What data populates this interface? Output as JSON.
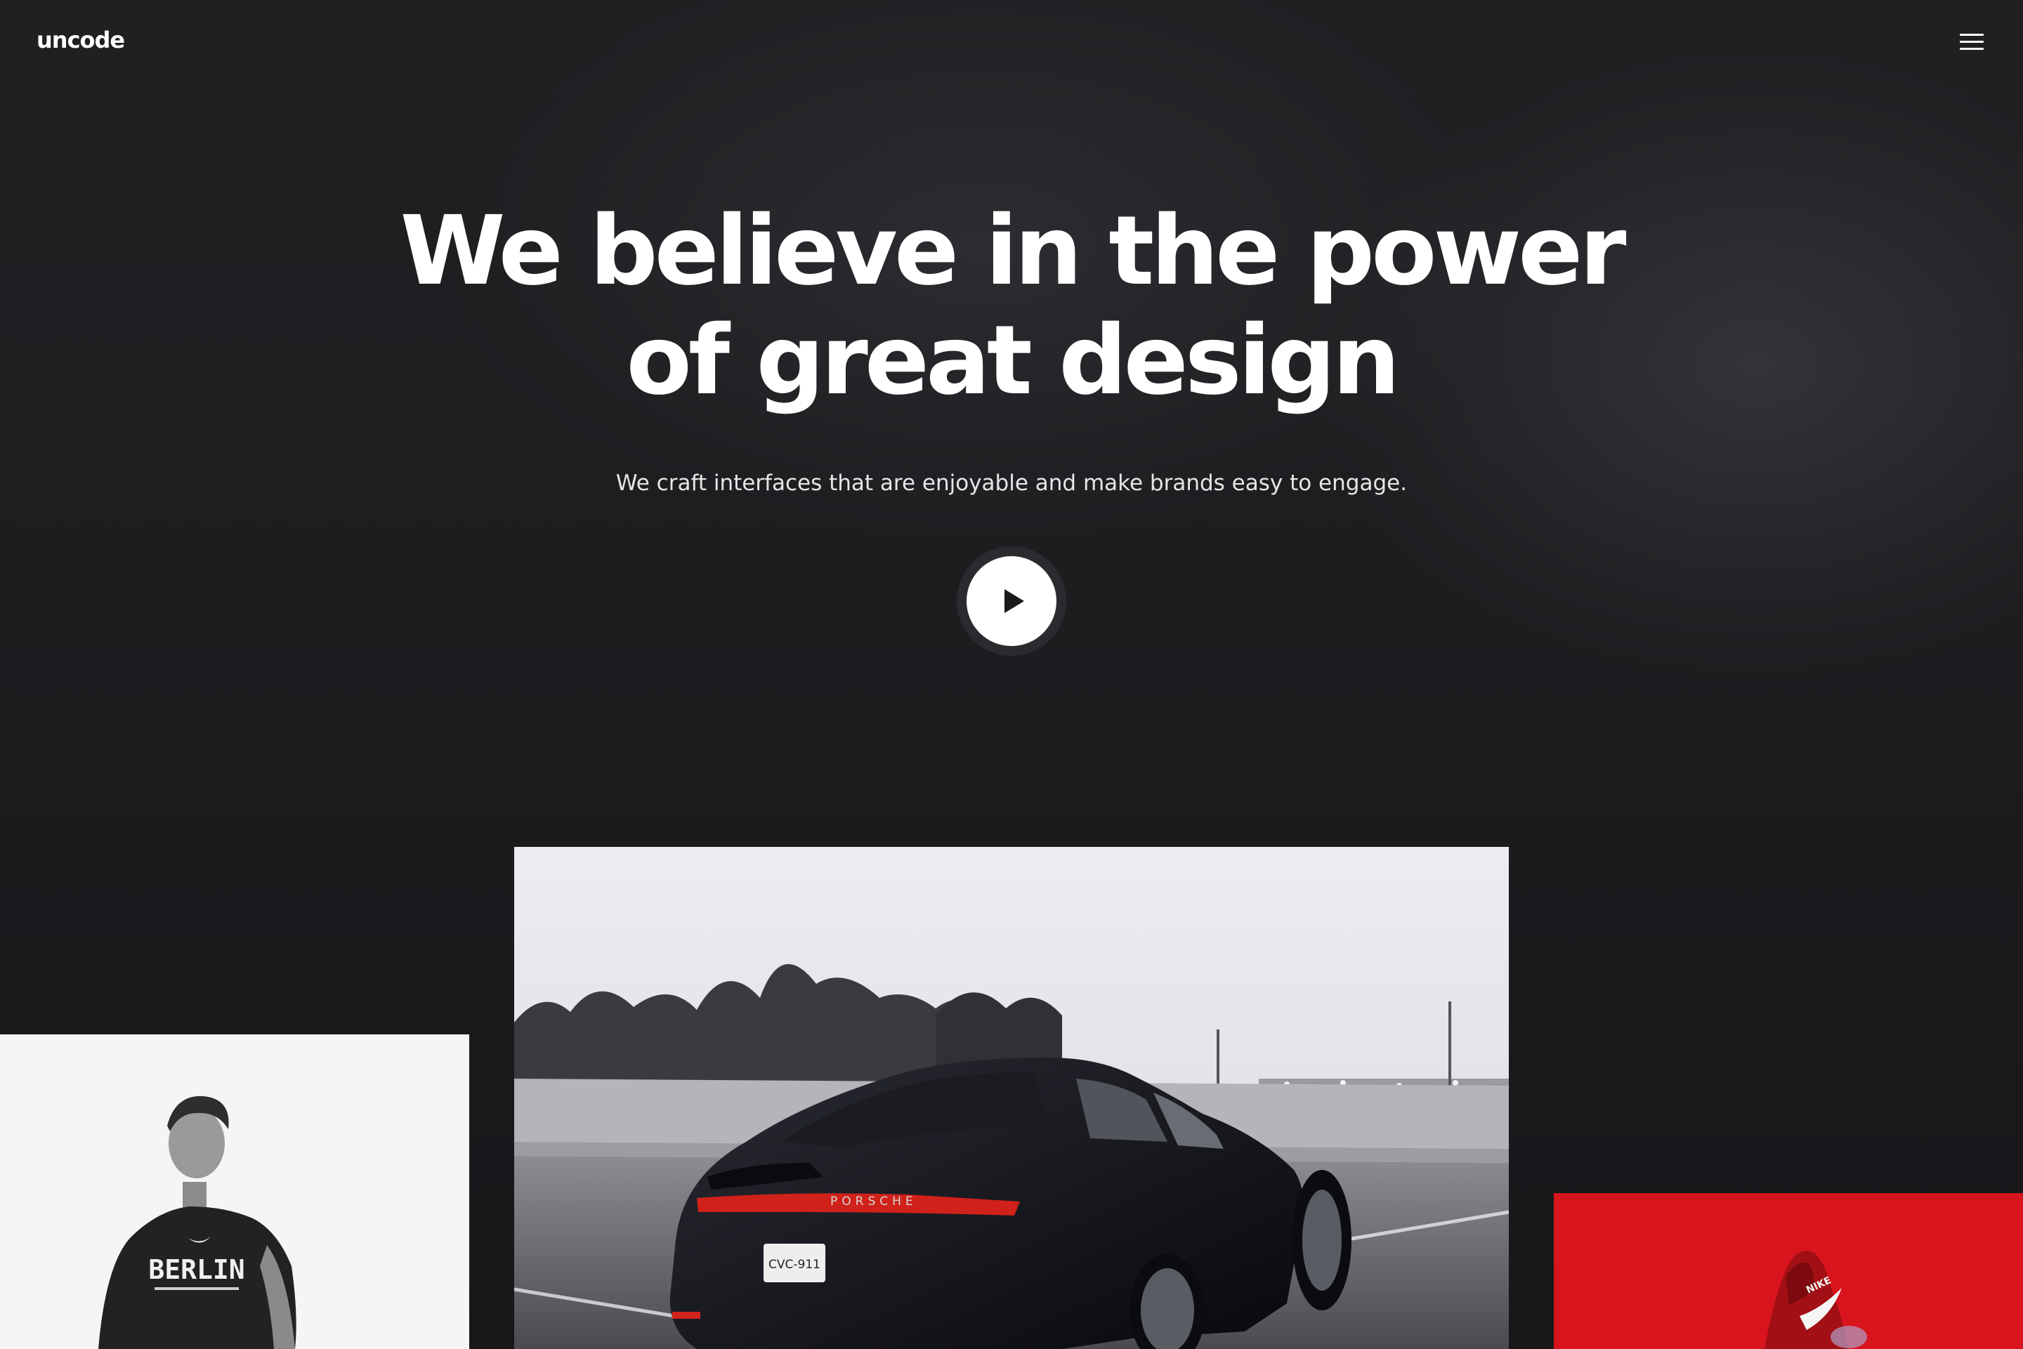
{
  "header": {
    "logo": "uncode",
    "menu_icon": "hamburger-menu-icon"
  },
  "hero": {
    "title_line1": "We believe in the power",
    "title_line2": "of great design",
    "subtitle": "We craft interfaces that are enjoyable and make brands easy to engage.",
    "play_icon": "play-icon"
  },
  "gallery": {
    "car_card": {
      "plate_text": "CVC-911",
      "brand_text": "PORSCHE"
    },
    "person_card": {
      "shirt_text": "BERLIN"
    },
    "shoe_card": {
      "brand_text": "NIKE"
    }
  },
  "colors": {
    "background": "#1d1d20",
    "text": "#ffffff",
    "accent_red": "#d81420"
  }
}
